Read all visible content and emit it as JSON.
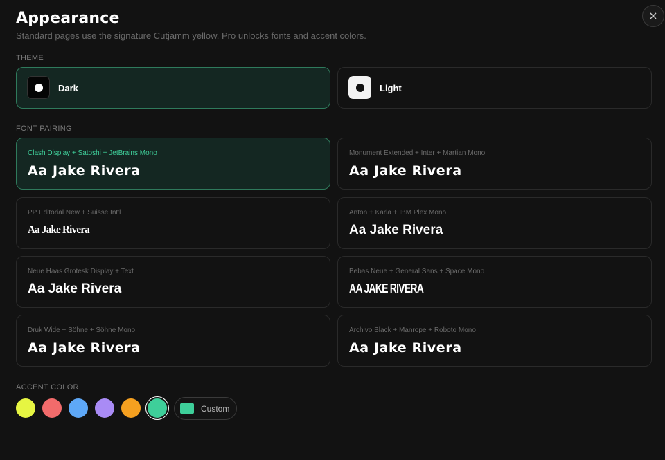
{
  "header": {
    "title": "Appearance",
    "subtitle": "Standard pages use the signature Cutjamm yellow. Pro unlocks fonts and accent colors.",
    "close_glyph": "×"
  },
  "theme": {
    "label": "THEME",
    "options": [
      {
        "label": "Dark",
        "selected": true
      },
      {
        "label": "Light",
        "selected": false
      }
    ]
  },
  "font_pairing": {
    "label": "FONT PAIRING",
    "options": [
      {
        "meta": "Clash Display + Satoshi + JetBrains Mono",
        "sample": "Aa Jake Rivera",
        "selected": true
      },
      {
        "meta": "Monument Extended + Inter + Martian Mono",
        "sample": "Aa Jake Rivera",
        "selected": false
      },
      {
        "meta": "PP Editorial New + Suisse Int'l",
        "sample": "Aa Jake Rivera",
        "selected": false
      },
      {
        "meta": "Anton + Karla + IBM Plex Mono",
        "sample": "Aa Jake Rivera",
        "selected": false
      },
      {
        "meta": "Neue Haas Grotesk Display + Text",
        "sample": "Aa Jake Rivera",
        "selected": false
      },
      {
        "meta": "Bebas Neue + General Sans + Space Mono",
        "sample": "AA JAKE RIVERA",
        "selected": false
      },
      {
        "meta": "Druk Wide + Söhne + Söhne Mono",
        "sample": "Aa Jake Rivera",
        "selected": false
      },
      {
        "meta": "Archivo Black + Manrope + Roboto Mono",
        "sample": "Aa Jake Rivera",
        "selected": false
      }
    ]
  },
  "accent": {
    "label": "ACCENT COLOR",
    "swatches": [
      "#e6f542",
      "#f26b6b",
      "#5ea8f7",
      "#a98bf5",
      "#f5a020",
      "#3ecf9a"
    ],
    "selected_color": "#3ecf9a",
    "custom_label": "Custom"
  }
}
